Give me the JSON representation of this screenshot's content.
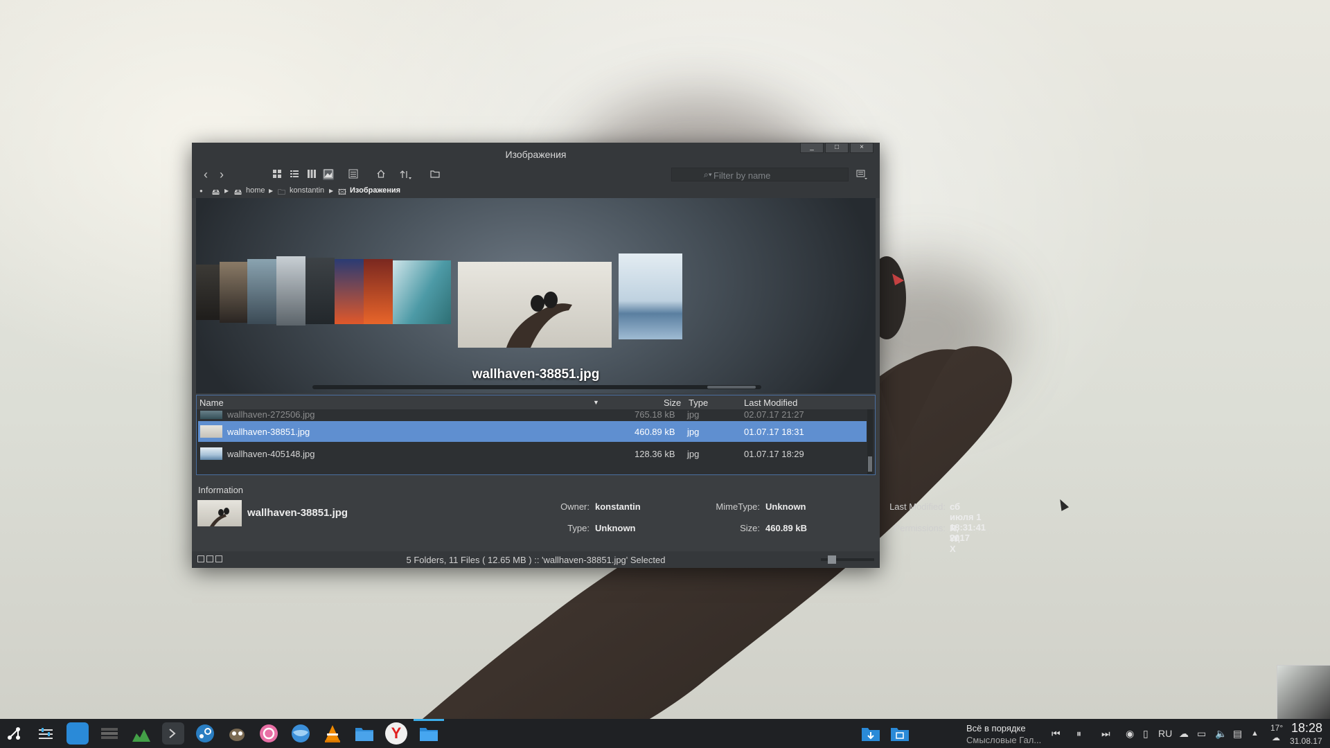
{
  "window": {
    "title": "Изображения",
    "minimize_glyph": "_",
    "maximize_glyph": "□",
    "close_glyph": "×"
  },
  "toolbar": {
    "back_glyph": "‹",
    "forward_glyph": "›",
    "icons": [
      "icon-view-icon",
      "details-view-icon",
      "columns-view-icon",
      "coverflow-view-icon",
      "preview-icon",
      "home-icon",
      "sort-icon",
      "new-folder-icon"
    ],
    "filter_placeholder": "Filter by name"
  },
  "breadcrumb": {
    "segments": [
      "home",
      "konstantin",
      "Изображения"
    ]
  },
  "coverflow": {
    "current_name": "wallhaven-38851.jpg"
  },
  "file_list": {
    "columns": {
      "name": "Name",
      "size": "Size",
      "type": "Type",
      "modified": "Last Modified"
    },
    "rows": [
      {
        "name": "wallhaven-272506.jpg",
        "size": "765.18 kB",
        "type": "jpg",
        "modified": "02.07.17 21:27"
      },
      {
        "name": "wallhaven-38851.jpg",
        "size": "460.89 kB",
        "type": "jpg",
        "modified": "01.07.17 18:31"
      },
      {
        "name": "wallhaven-405148.jpg",
        "size": "128.36 kB",
        "type": "jpg",
        "modified": "01.07.17 18:29"
      }
    ],
    "selected_index": 1
  },
  "info_panel": {
    "title": "Information",
    "file_name": "wallhaven-38851.jpg",
    "owner_label": "Owner:",
    "owner": "konstantin",
    "type_label": "Type:",
    "type": "Unknown",
    "mime_label": "MimeType:",
    "mime": "Unknown",
    "size_label": "Size:",
    "size": "460.89 kB",
    "modified_label": "Last Modified:",
    "modified": "сб июля 1 18:31:41 2017",
    "permissions_label": "Permissions:",
    "permissions": "R, W, X"
  },
  "status": {
    "text": "5 Folders, 11 Files ( 12.65 MB ) :: 'wallhaven-38851.jpg' Selected"
  },
  "taskbar": {
    "apps": [
      "launcher-icon",
      "settings-icon",
      "store-icon",
      "dolphin-icon",
      "system-monitor-icon",
      "terminal-icon",
      "steam-icon",
      "gimp-icon",
      "osu-icon",
      "browser-icon",
      "vlc-icon",
      "files-icon",
      "yandex-browser-icon",
      "file-manager-icon"
    ],
    "yandex_glyph": "Y",
    "notification_title": "Всё в порядке",
    "notification_subtitle": "Смысловые Гал...",
    "keyboard_layout": "RU",
    "temperature": "17°",
    "clock": "18:28",
    "date": "31.08.17"
  }
}
